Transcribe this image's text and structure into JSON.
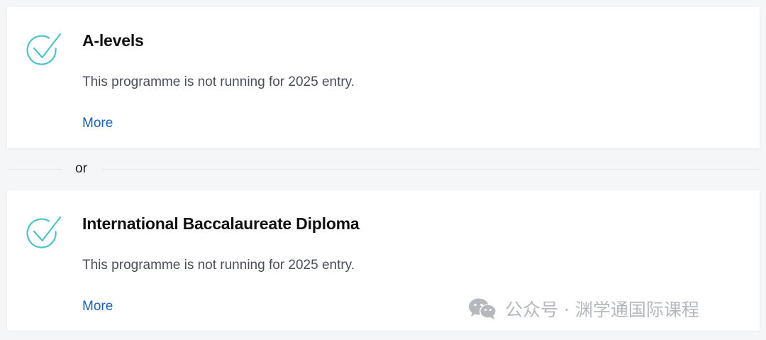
{
  "options": [
    {
      "title": "A-levels",
      "description": "This programme is not running for 2025 entry.",
      "link_label": "More",
      "icon": "check-circle-icon"
    },
    {
      "title": "International Baccalaureate Diploma",
      "description": "This programme is not running for 2025 entry.",
      "link_label": "More",
      "icon": "check-circle-icon"
    }
  ],
  "separator": {
    "label": "or"
  },
  "watermark": {
    "text": "公众号 · 渊学通国际课程",
    "icon": "wechat-icon"
  },
  "colors": {
    "icon_accent": "#4cc3cc",
    "link": "#1a5fb4",
    "title": "#111111",
    "description": "#4a4f57"
  }
}
